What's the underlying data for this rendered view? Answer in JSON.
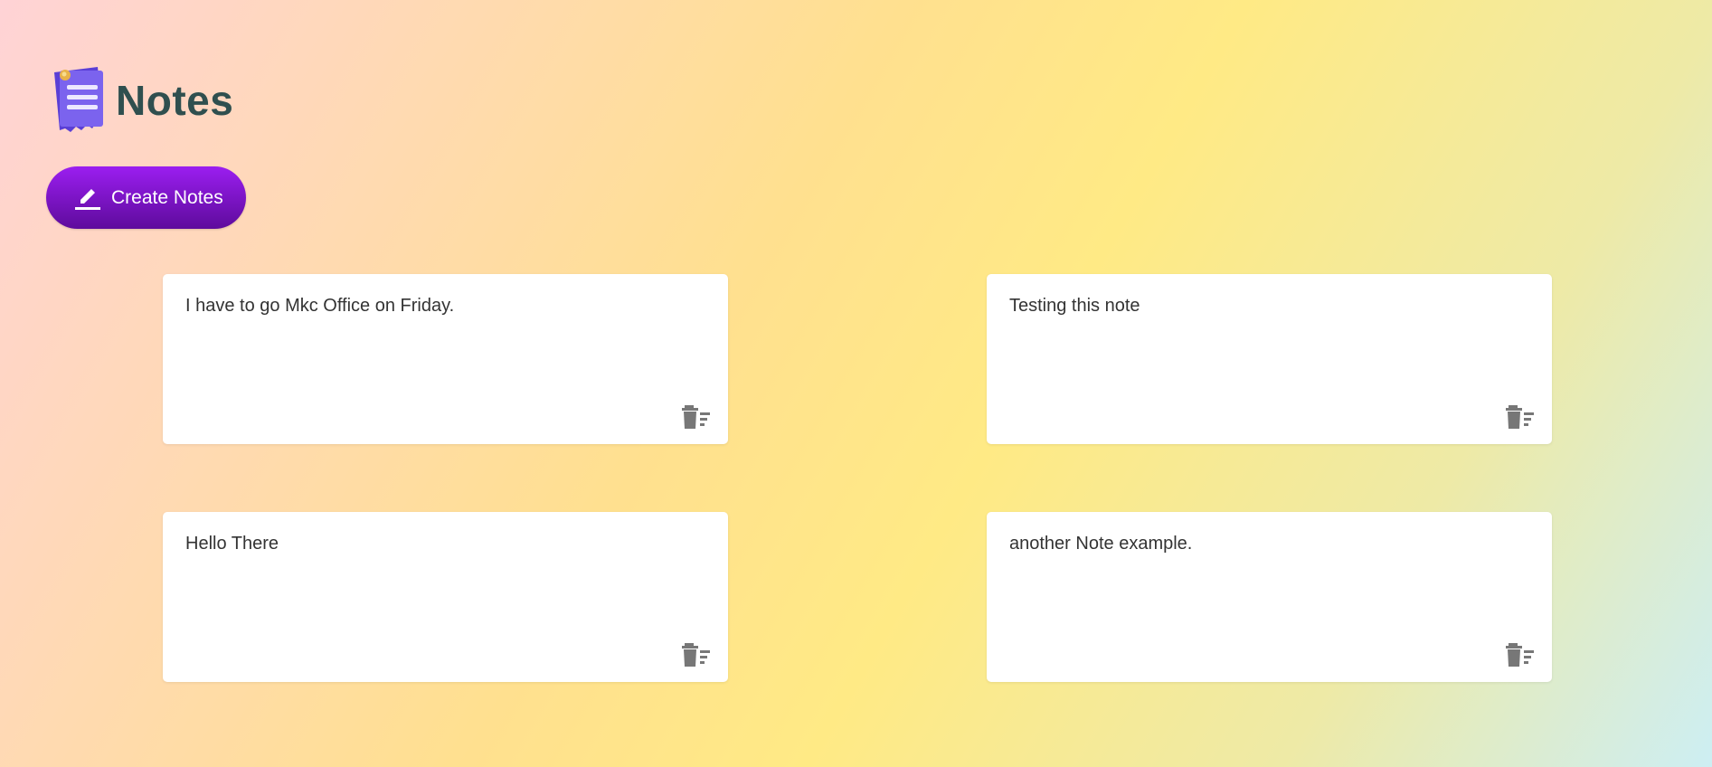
{
  "app": {
    "title": "Notes",
    "logo_icon": "notes-logo-icon",
    "accent_color": "#8a16dc"
  },
  "toolbar": {
    "create_label": "Create Notes",
    "create_icon": "pencil-icon"
  },
  "notes": [
    {
      "text": "I have to go Mkc Office on Friday.",
      "delete_icon": "delete-icon"
    },
    {
      "text": "Testing this note",
      "delete_icon": "delete-icon"
    },
    {
      "text": "Hello There",
      "delete_icon": "delete-icon"
    },
    {
      "text": "another Note example.",
      "delete_icon": "delete-icon"
    }
  ]
}
